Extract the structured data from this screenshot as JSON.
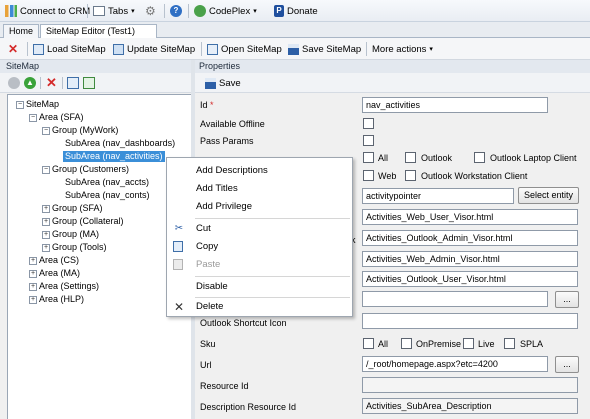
{
  "topbar": {
    "connect_label": "Connect to CRM",
    "tabs_label": "Tabs",
    "codeplex_label": "CodePlex",
    "donate_label": "Donate"
  },
  "tabs": [
    {
      "label": "Home"
    },
    {
      "label": "SiteMap Editor (Test1)"
    }
  ],
  "toolbar": {
    "load_label": "Load SiteMap",
    "update_label": "Update SiteMap",
    "open_label": "Open SiteMap",
    "save_label": "Save SiteMap",
    "more_label": "More actions"
  },
  "left": {
    "header": "SiteMap",
    "tree": [
      {
        "label": "SiteMap"
      },
      {
        "label": "Area (SFA)"
      },
      {
        "label": "Group (MyWork)"
      },
      {
        "label": "SubArea (nav_dashboards)"
      },
      {
        "label": "SubArea (nav_activities)"
      },
      {
        "label": "Group (Customers)"
      },
      {
        "label": "SubArea (nav_accts)"
      },
      {
        "label": "SubArea (nav_conts)"
      },
      {
        "label": "Group (SFA)"
      },
      {
        "label": "Group (Collateral)"
      },
      {
        "label": "Group (MA)"
      },
      {
        "label": "Group (Tools)"
      },
      {
        "label": "Area (CS)"
      },
      {
        "label": "Area (MA)"
      },
      {
        "label": "Area (Settings)"
      },
      {
        "label": "Area (HLP)"
      }
    ]
  },
  "right": {
    "header": "Properties",
    "save_label": "Save"
  },
  "form": {
    "id_label": "Id",
    "required_mark": "*",
    "id_value": "nav_activities",
    "available_offline_label": "Available Offline",
    "pass_params_label": "Pass Params",
    "client_options": [
      "All",
      "Outlook",
      "Outlook Laptop Client",
      "Web",
      "Outlook Workstation Client"
    ],
    "entity_value": "activitypointer",
    "select_entity_label": "Select entity",
    "icon_value": "Activities_Web_User_Visor.html",
    "icon_label_fragment": "k",
    "outlook_admin_value": "Activities_Outlook_Admin_Visor.html",
    "web_admin_value": "Activities_Web_Admin_Visor.html",
    "outlook_user_value": "Activities_Outlook_User_Visor.html",
    "browse_label": "...",
    "outlook_shortcut_icon_label": "Outlook Shortcut Icon",
    "sku_label": "Sku",
    "sku_options": [
      "All",
      "OnPremise",
      "Live",
      "SPLA"
    ],
    "url_label": "Url",
    "url_value": "/_root/homepage.aspx?etc=4200",
    "resource_id_label": "Resource Id",
    "description_resource_id_label": "Description Resource Id",
    "description_resource_id_value": "Activities_SubArea_Description"
  },
  "context_menu": {
    "add_descriptions": "Add Descriptions",
    "add_titles": "Add Titles",
    "add_privilege": "Add Privilege",
    "cut": "Cut",
    "copy": "Copy",
    "paste": "Paste",
    "disable": "Disable",
    "delete": "Delete"
  },
  "colors": {
    "selection": "#3b8fd8",
    "delete_red": "#d42a2a",
    "nav_green": "#3aa23a"
  }
}
